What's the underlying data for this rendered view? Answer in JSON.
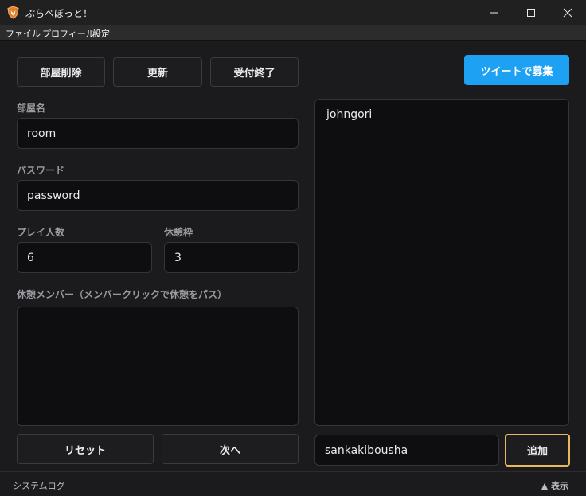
{
  "window": {
    "title": "ぷらべぼっと！",
    "app_icon": "shield-fox-icon",
    "minimize_icon": "minimize-icon",
    "maximize_icon": "maximize-icon",
    "close_icon": "close-icon"
  },
  "menu": {
    "items": [
      "ファイル",
      "プロフィール",
      "設定"
    ]
  },
  "toolbar": {
    "delete_room": "部屋削除",
    "update": "更新",
    "close_reception": "受付終了",
    "tweet_recruit": "ツイートで募集"
  },
  "form": {
    "room_name": {
      "label": "部屋名",
      "value": "room"
    },
    "password": {
      "label": "パスワード",
      "value": "password"
    },
    "players": {
      "label": "プレイ人数",
      "value": "6"
    },
    "rest_slots": {
      "label": "休憩枠",
      "value": "3"
    },
    "rest_members": {
      "label": "休憩メンバー（メンバークリックで休憩をパス）",
      "items": []
    }
  },
  "actions": {
    "reset": "リセット",
    "next": "次へ"
  },
  "members": {
    "list": [
      "johngori"
    ],
    "new_member_value": "sankakibousha",
    "add_label": "追加"
  },
  "status": {
    "log_label": "システムログ",
    "toggle_label": "▲ 表示"
  },
  "colors": {
    "accent": "#1da1f2",
    "focus": "#e8b860",
    "background": "#1b1b1d"
  }
}
